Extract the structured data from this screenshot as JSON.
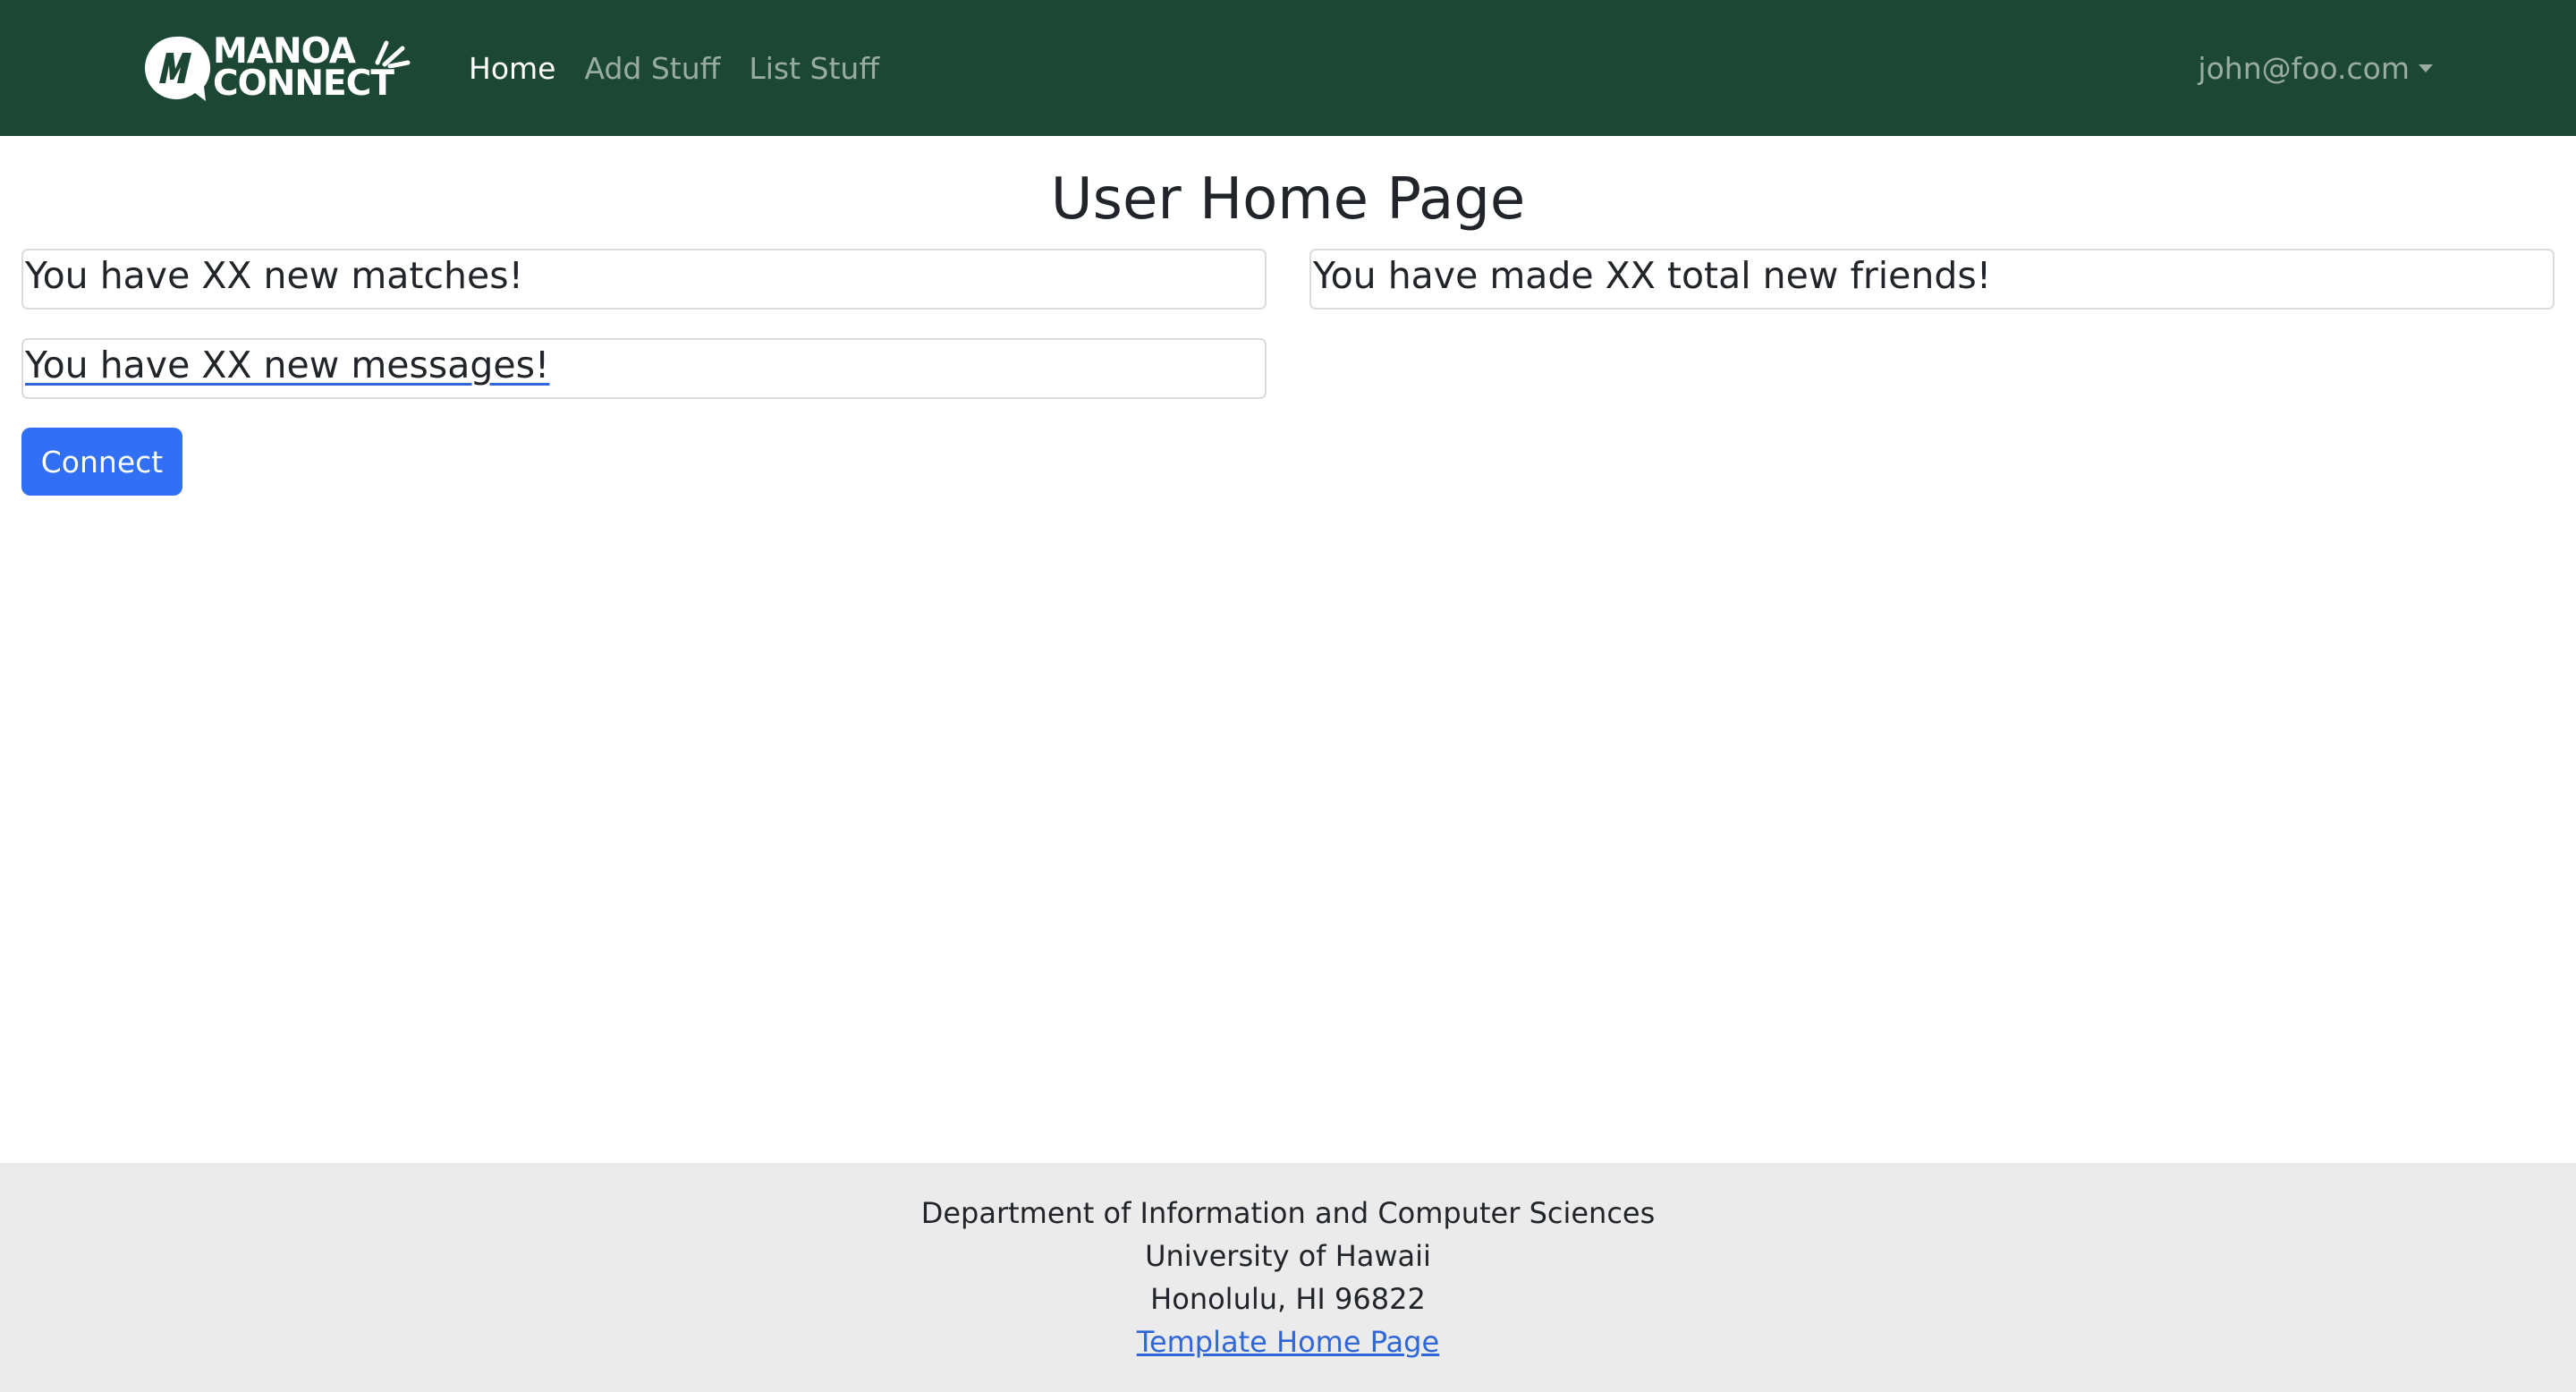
{
  "navbar": {
    "logo": {
      "line1": "MANOA",
      "line2": "CONNECT"
    },
    "links": [
      {
        "label": "Home",
        "active": true
      },
      {
        "label": "Add Stuff",
        "active": false
      },
      {
        "label": "List Stuff",
        "active": false
      }
    ],
    "user": "john@foo.com",
    "background_color": "#1c4734"
  },
  "main": {
    "title": "User Home Page",
    "cards": {
      "matches": "You have XX new matches!",
      "friends": "You have made XX total new friends!",
      "messages": "You have XX new messages!"
    },
    "connect_button": "Connect",
    "button_color": "#316ff4"
  },
  "footer": {
    "line1": "Department of Information and Computer Sciences",
    "line2": "University of Hawaii",
    "line3": "Honolulu, HI 96822",
    "link": "Template Home Page",
    "background_color": "#ebebeb"
  }
}
